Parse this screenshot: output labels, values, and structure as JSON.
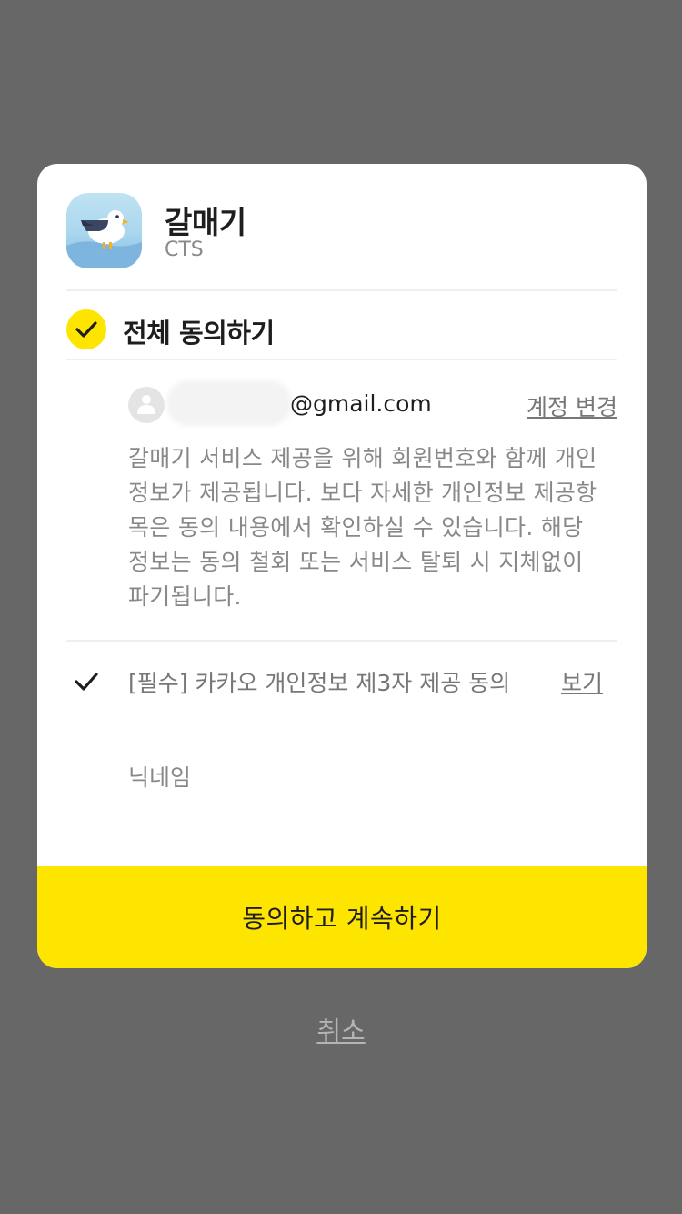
{
  "app": {
    "name": "갈매기",
    "developer": "CTS",
    "icon": "seagull-app-icon"
  },
  "agree_all": {
    "label": "전체 동의하기",
    "checked": true
  },
  "account": {
    "email": "@gmail.com",
    "change_label": "계정 변경"
  },
  "description": "갈매기 서비스 제공을 위해 회원번호와 함께 개인정보가 제공됩니다. 보다 자세한 개인정보 제공항목은 동의 내용에서 확인하실 수 있습니다. 해당 정보는 동의 철회 또는 서비스 탈퇴 시 지체없이 파기됩니다.",
  "required_item": {
    "label": "[필수] 카카오 개인정보 제3자 제공 동의",
    "view_label": "보기",
    "checked": true,
    "fields": [
      "닉네임"
    ]
  },
  "buttons": {
    "continue": "동의하고 계속하기",
    "cancel": "취소"
  },
  "colors": {
    "accent": "#fee500",
    "overlay": "#676767",
    "text_primary": "#1e1e1e",
    "text_secondary": "#888888"
  }
}
